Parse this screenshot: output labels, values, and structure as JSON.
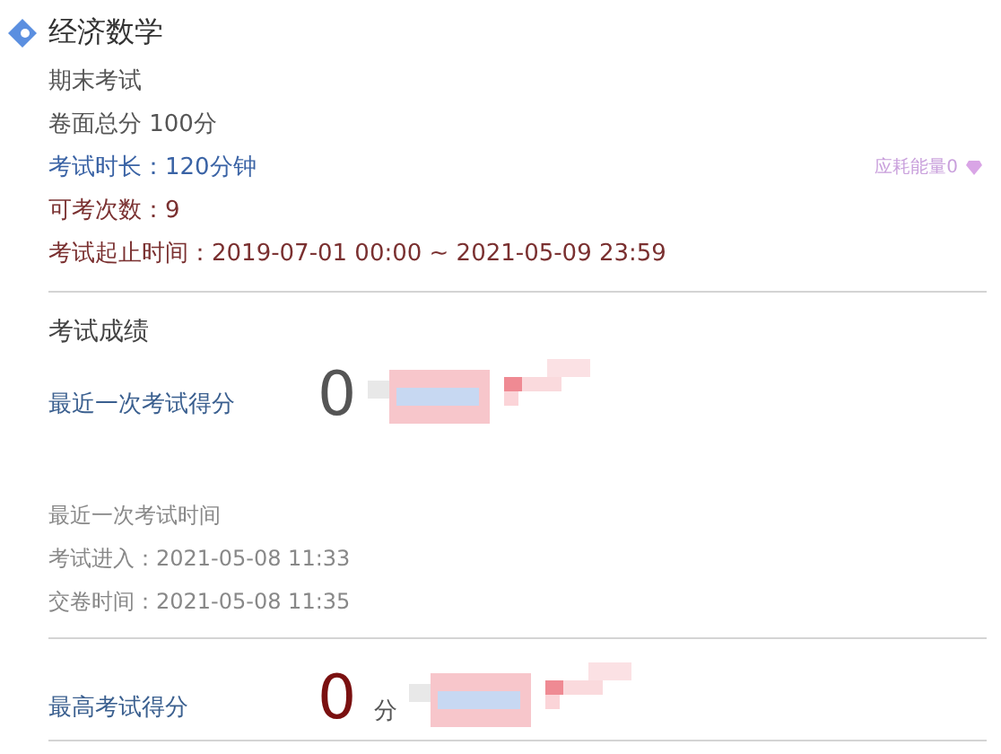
{
  "course": {
    "title": "经济数学"
  },
  "exam": {
    "name": "期末考试",
    "total": "卷面总分 100分",
    "duration": "考试时长：120分钟",
    "attempts": "可考次数：9",
    "period": "考试起止时间：2019-07-01 00:00 ~ 2021-05-09 23:59",
    "energy": "应耗能量0"
  },
  "results": {
    "heading": "考试成绩",
    "latest": {
      "label": "最近一次考试得分",
      "score": "0"
    },
    "times": [
      "最近一次考试时间",
      "考试进入：2021-05-08 11:33",
      "交卷时间：2021-05-08 11:35"
    ],
    "best": {
      "label": "最高考试得分",
      "score": "0",
      "unit": "分"
    }
  }
}
